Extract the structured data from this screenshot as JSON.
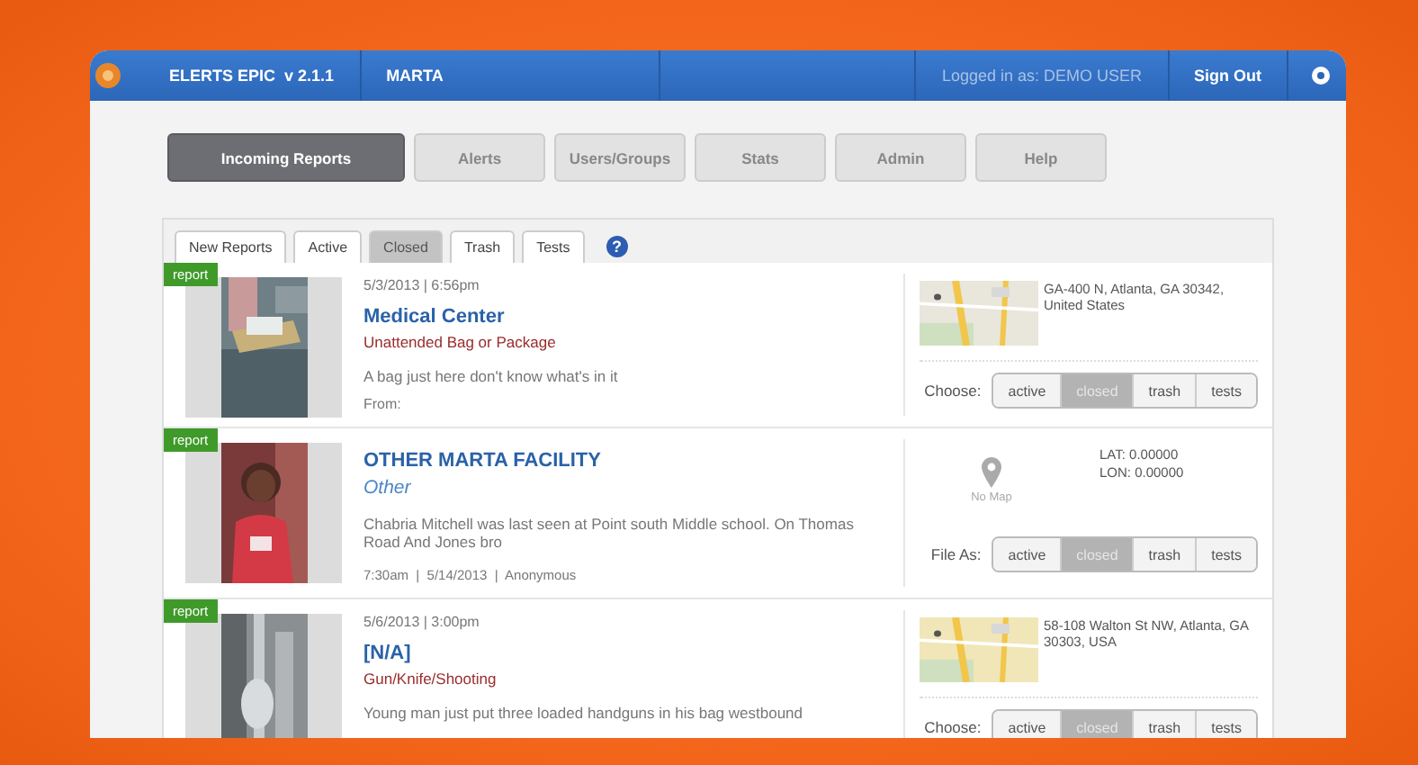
{
  "header": {
    "app_name": "ELERTS EPIC",
    "version": "v 2.1.1",
    "agency": "MARTA",
    "logged_in": "Logged in as: DEMO USER",
    "sign_out": "Sign Out"
  },
  "nav": [
    {
      "label": "Incoming Reports",
      "selected": true
    },
    {
      "label": "Alerts",
      "selected": false
    },
    {
      "label": "Users/Groups",
      "selected": false
    },
    {
      "label": "Stats",
      "selected": false
    },
    {
      "label": "Admin",
      "selected": false
    },
    {
      "label": "Help",
      "selected": false
    }
  ],
  "tabs": [
    {
      "label": "New Reports",
      "selected": false
    },
    {
      "label": "Active",
      "selected": false
    },
    {
      "label": "Closed",
      "selected": true
    },
    {
      "label": "Trash",
      "selected": false
    },
    {
      "label": "Tests",
      "selected": false
    }
  ],
  "help": "?",
  "reports": [
    {
      "kind": "located",
      "badge": "report",
      "photo": {
        "kind": "picture"
      },
      "timestamp": "5/3/2013 | 6:56pm",
      "title": "Medical Center",
      "category": "Unattended Bag or Package",
      "description": "A bag just here don't know what's in it",
      "from": "From:",
      "address": "GA-400 N, Atlanta, GA 30342, United States",
      "file_label": "Choose:",
      "options": [
        {
          "label": "active",
          "selected": false
        },
        {
          "label": "closed",
          "selected": true
        },
        {
          "label": "trash",
          "selected": false
        },
        {
          "label": "tests",
          "selected": false
        }
      ]
    },
    {
      "kind": "unlocated",
      "badge": "report",
      "photo": {
        "kind": "picture"
      },
      "title": "OTHER MARTA FACILITY",
      "category": "Other",
      "description": "Chabria Mitchell was last seen at Point south Middle school. On Thomas Road And Jones bro",
      "footer": "7:30am  |  5/14/2013  |  Anonymous",
      "no_map": "No Map",
      "coords": [
        "LAT: 0.00000",
        "LON: 0.00000"
      ],
      "file_label": "File As:",
      "options": [
        {
          "label": "active",
          "selected": false
        },
        {
          "label": "closed",
          "selected": true
        },
        {
          "label": "trash",
          "selected": false
        },
        {
          "label": "tests",
          "selected": false
        }
      ]
    },
    {
      "kind": "located",
      "badge": "report",
      "photo": {
        "kind": "picture"
      },
      "timestamp": "5/6/2013 | 3:00pm",
      "title": "[N/A]",
      "category": "Gun/Knife/Shooting",
      "description": "Young man just put three loaded handguns in his bag westbound",
      "address": "58-108 Walton St NW, Atlanta, GA 30303, USA",
      "file_label": "Choose:",
      "options": [
        {
          "label": "active",
          "selected": false
        },
        {
          "label": "closed",
          "selected": true
        },
        {
          "label": "trash",
          "selected": false
        },
        {
          "label": "tests",
          "selected": false
        }
      ]
    }
  ]
}
